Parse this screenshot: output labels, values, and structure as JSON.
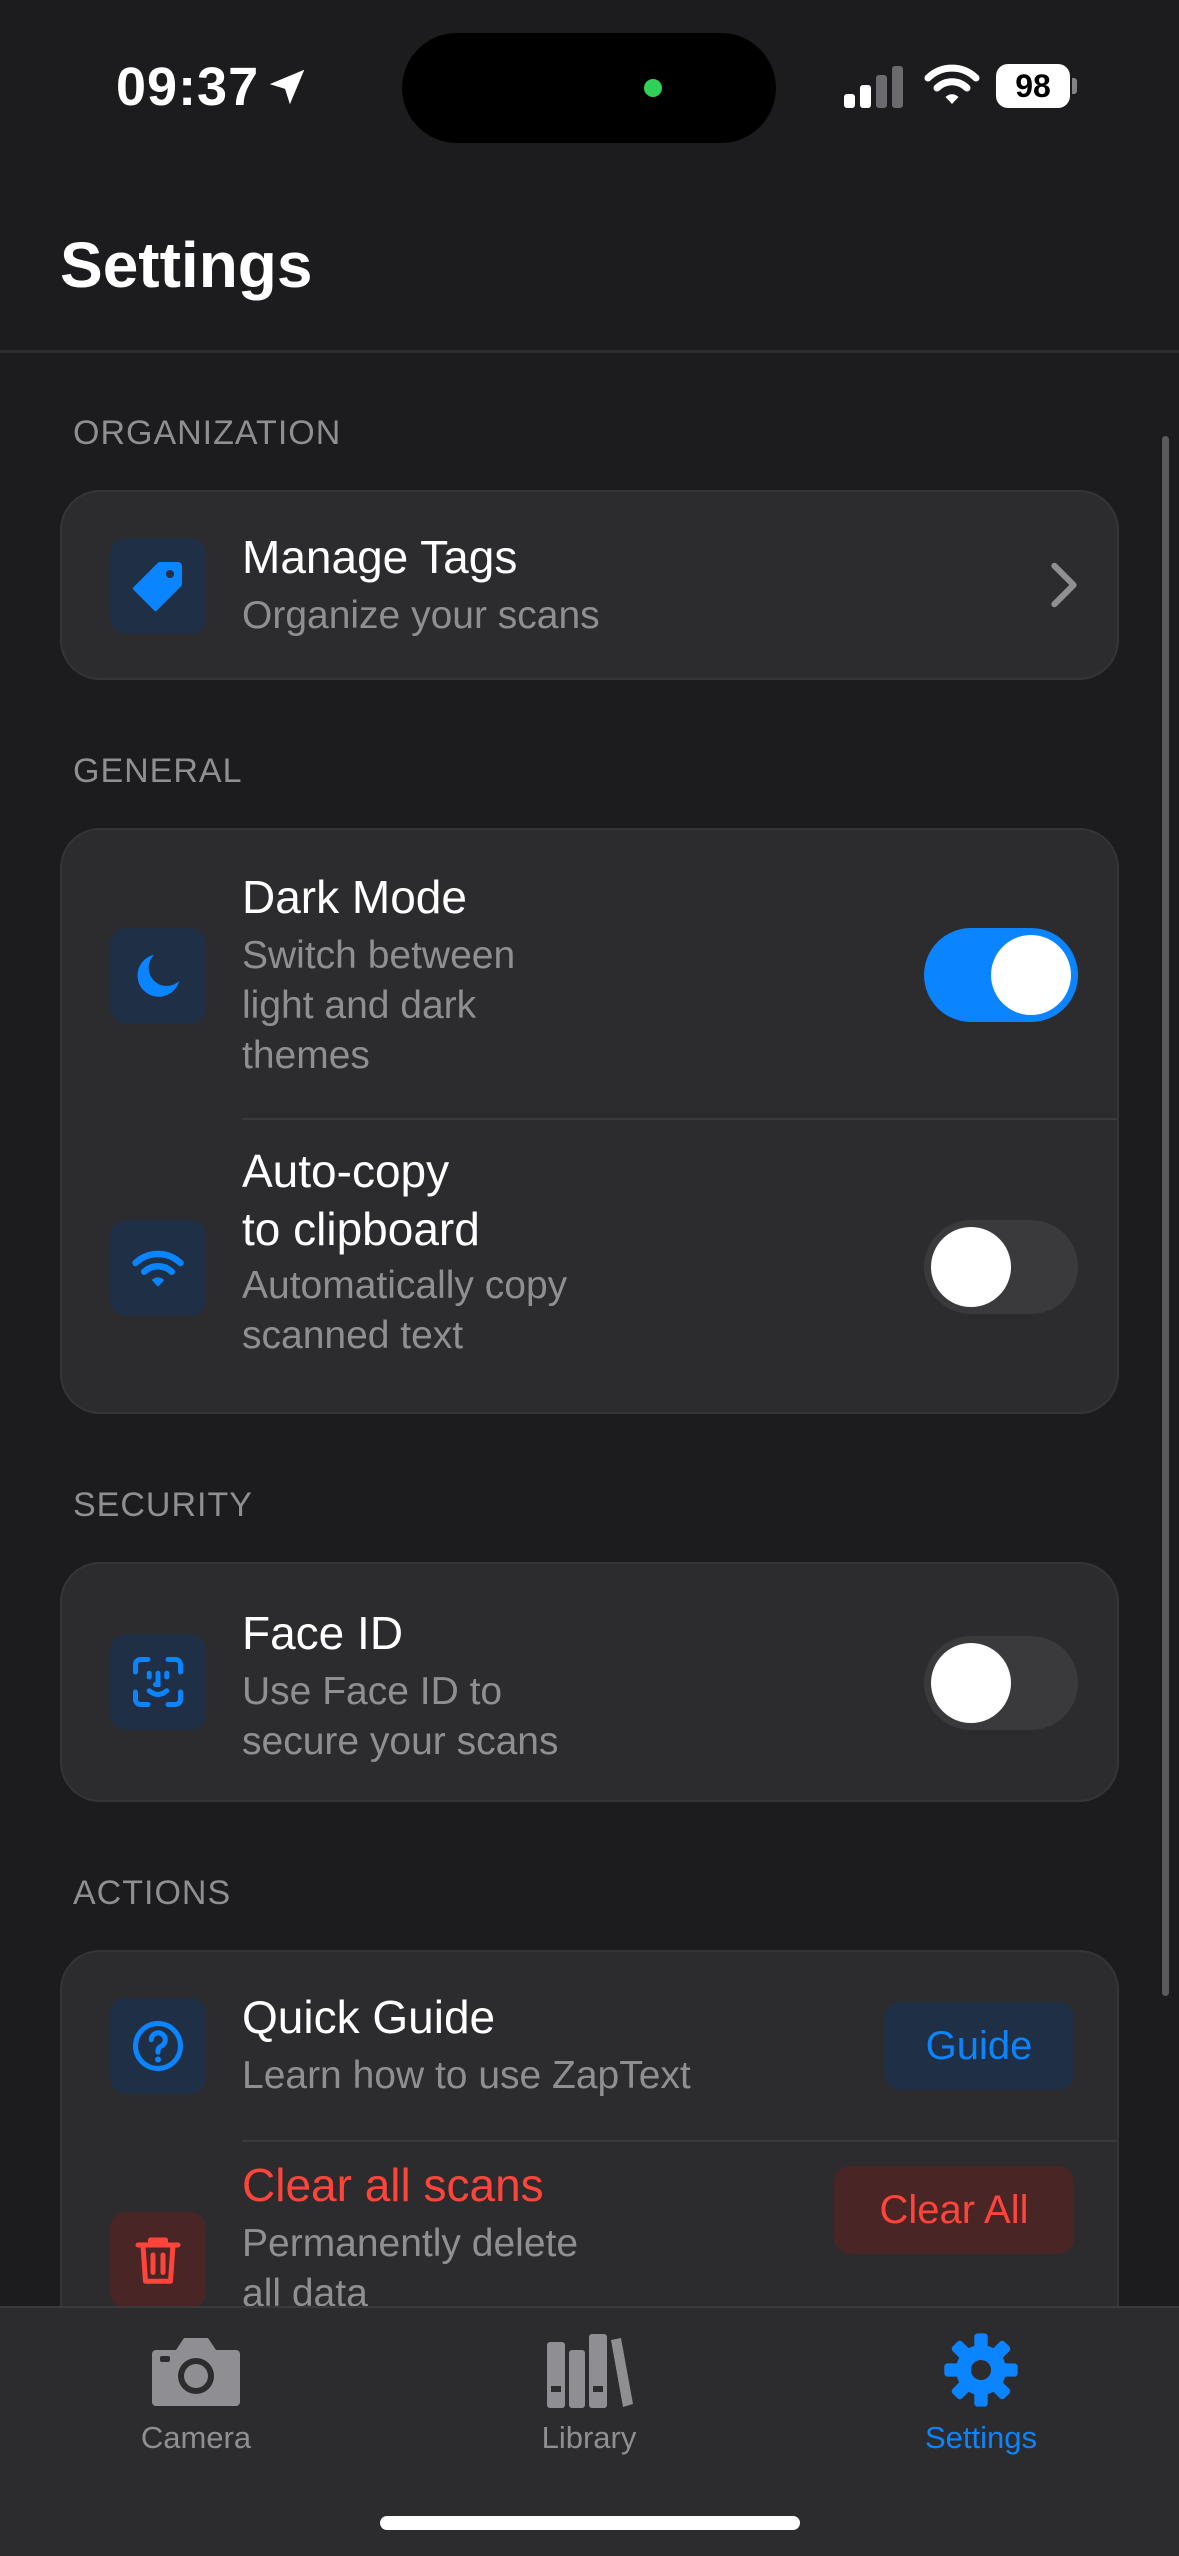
{
  "status_bar": {
    "time": "09:37",
    "battery": "98"
  },
  "header": {
    "title": "Settings"
  },
  "sections": {
    "organization": {
      "label": "ORGANIZATION",
      "manage_tags": {
        "title": "Manage Tags",
        "subtitle": "Organize your scans"
      }
    },
    "general": {
      "label": "GENERAL",
      "dark_mode": {
        "title": "Dark Mode",
        "subtitle_lines": [
          "Switch between",
          "light and dark",
          "themes"
        ],
        "enabled": true
      },
      "auto_copy": {
        "title_lines": [
          "Auto-copy",
          "to clipboard"
        ],
        "subtitle_lines": [
          "Automatically copy",
          "scanned text"
        ],
        "enabled": false
      }
    },
    "security": {
      "label": "SECURITY",
      "face_id": {
        "title": "Face ID",
        "subtitle_lines": [
          "Use Face ID to",
          "secure your scans"
        ],
        "enabled": false
      }
    },
    "actions": {
      "label": "ACTIONS",
      "quick_guide": {
        "title": "Quick Guide",
        "subtitle": "Learn how to use ZapText",
        "button": "Guide"
      },
      "clear_scans": {
        "title": "Clear all scans",
        "subtitle_lines": [
          "Permanently delete",
          "all data"
        ],
        "button": "Clear All"
      }
    }
  },
  "tab_bar": {
    "camera": "Camera",
    "library": "Library",
    "settings": "Settings",
    "active": "settings"
  },
  "colors": {
    "accent": "#0a84ff",
    "danger": "#ff453a",
    "background": "#1c1c1e",
    "card": "#2c2c2e",
    "secondary_text": "#8e8e93"
  }
}
